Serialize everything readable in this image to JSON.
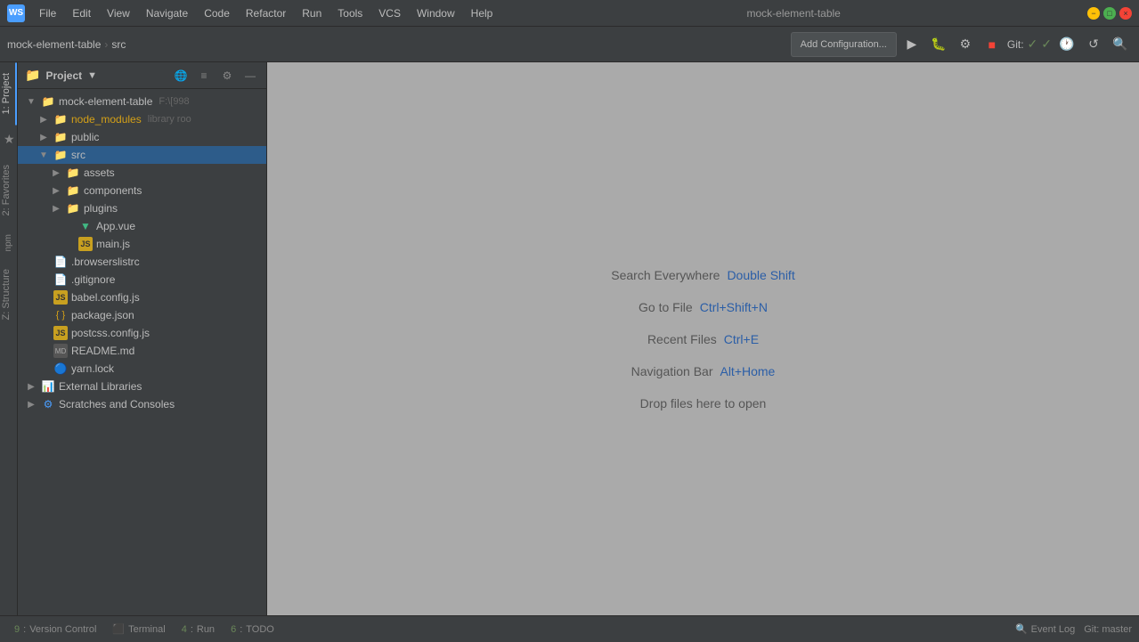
{
  "titlebar": {
    "logo": "WS",
    "title": "mock-element-table",
    "menu": [
      "File",
      "Edit",
      "View",
      "Navigate",
      "Code",
      "Refactor",
      "Run",
      "Tools",
      "VCS",
      "Window",
      "Help"
    ]
  },
  "toolbar": {
    "breadcrumb": [
      "mock-element-table",
      "src"
    ],
    "add_config_label": "Add Configuration...",
    "git_label": "Git:",
    "search_icon": "🔍"
  },
  "project_panel": {
    "title": "Project",
    "dropdown_arrow": "▼",
    "root": {
      "name": "mock-element-table",
      "path": "F:\\[998",
      "children": [
        {
          "type": "folder",
          "name": "node_modules",
          "suffix": "library roo",
          "expanded": false
        },
        {
          "type": "folder",
          "name": "public",
          "expanded": false
        },
        {
          "type": "folder",
          "name": "src",
          "expanded": true,
          "children": [
            {
              "type": "folder",
              "name": "assets",
              "expanded": false
            },
            {
              "type": "folder",
              "name": "components",
              "expanded": false
            },
            {
              "type": "folder",
              "name": "plugins",
              "expanded": false
            },
            {
              "type": "vue",
              "name": "App.vue"
            },
            {
              "type": "js",
              "name": "main.js"
            }
          ]
        },
        {
          "type": "dot",
          "name": ".browserslistrc"
        },
        {
          "type": "dot",
          "name": ".gitignore"
        },
        {
          "type": "config",
          "name": "babel.config.js"
        },
        {
          "type": "json",
          "name": "package.json"
        },
        {
          "type": "config",
          "name": "postcss.config.js"
        },
        {
          "type": "md",
          "name": "README.md"
        },
        {
          "type": "yarn",
          "name": "yarn.lock"
        }
      ]
    },
    "external_libraries": "External Libraries",
    "scratches": "Scratches and Consoles"
  },
  "content": {
    "search_everywhere_label": "Search Everywhere",
    "search_everywhere_shortcut": "Double Shift",
    "goto_file_label": "Go to File",
    "goto_file_shortcut": "Ctrl+Shift+N",
    "recent_files_label": "Recent Files",
    "recent_files_shortcut": "Ctrl+E",
    "navigation_bar_label": "Navigation Bar",
    "navigation_bar_shortcut": "Alt+Home",
    "drop_files_label": "Drop files here to open"
  },
  "bottom_bar": {
    "tabs": [
      {
        "num": "9",
        "name": "Version Control"
      },
      {
        "num": "",
        "name": "Terminal"
      },
      {
        "num": "4",
        "name": "Run"
      },
      {
        "num": "6",
        "name": "TODO"
      }
    ],
    "event_log": "Event Log",
    "git_status": "Git: master"
  },
  "vertical_tabs": {
    "project": "1: Project",
    "favorites": "2: Favorites",
    "npm": "npm",
    "structure": "Z: Structure"
  }
}
